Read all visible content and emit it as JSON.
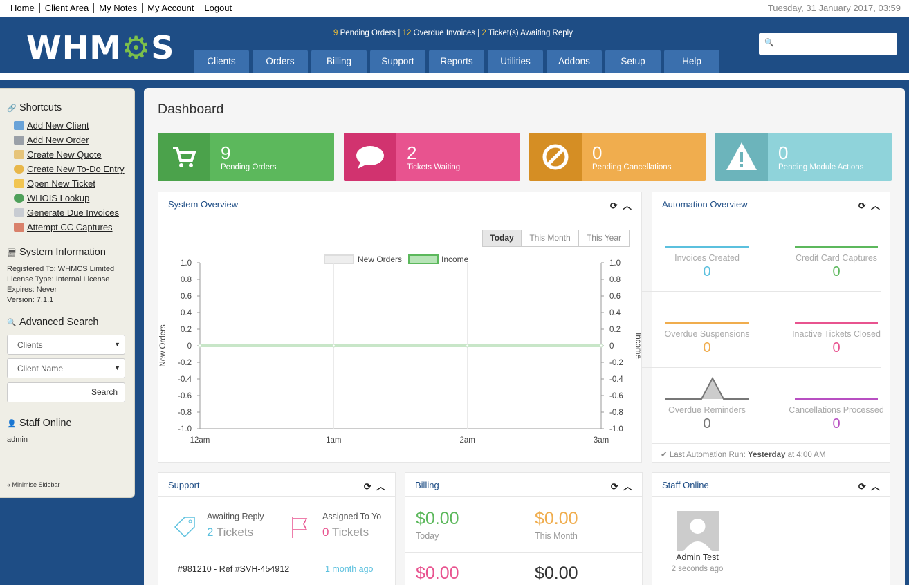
{
  "topbar": {
    "links": [
      "Home",
      "Client Area",
      "My Notes",
      "My Account",
      "Logout"
    ],
    "datetime": "Tuesday, 31 January 2017, 03:59"
  },
  "header": {
    "logo": "WHMCS",
    "alerts": {
      "pending_orders": "9",
      "pending_orders_label": "Pending Orders",
      "overdue": "12",
      "overdue_label": "Overdue Invoices",
      "tickets": "2",
      "tickets_label": "Ticket(s) Awaiting Reply",
      "separator": "|"
    },
    "search_icon": "search-icon"
  },
  "nav": [
    "Clients",
    "Orders",
    "Billing",
    "Support",
    "Reports",
    "Utilities",
    "Addons",
    "Setup",
    "Help"
  ],
  "sidebar": {
    "shortcuts_title": "Shortcuts",
    "shortcuts": [
      "Add New Client",
      "Add New Order",
      "Create New Quote",
      "Create New To-Do Entry",
      "Open New Ticket",
      "WHOIS Lookup",
      "Generate Due Invoices",
      "Attempt CC Captures"
    ],
    "sysinfo_title": "System Information",
    "sysinfo": [
      "Registered To: WHMCS Limited",
      "License Type: Internal License",
      "Expires: Never",
      "Version: 7.1.1"
    ],
    "adv_title": "Advanced Search",
    "adv_select1": "Clients",
    "adv_select2": "Client Name",
    "search_button": "Search",
    "staff_title": "Staff Online",
    "staff_name": "admin",
    "minimise": "« Minimise Sidebar"
  },
  "main": {
    "title": "Dashboard",
    "stats": [
      {
        "num": "9",
        "label": "Pending Orders",
        "color": "#5cb85c",
        "dark": "#4ba24b"
      },
      {
        "num": "2",
        "label": "Tickets Waiting",
        "color": "#e8538f",
        "dark": "#d1336f"
      },
      {
        "num": "0",
        "label": "Pending Cancellations",
        "color": "#f0ad4e",
        "dark": "#d58e24"
      },
      {
        "num": "0",
        "label": "Pending Module Actions",
        "color": "#8fd3da",
        "dark": "#6cb4bb"
      }
    ],
    "system_overview": {
      "title": "System Overview",
      "ranges": [
        "Today",
        "This Month",
        "This Year"
      ],
      "legend": [
        "New Orders",
        "Income"
      ]
    },
    "automation": {
      "title": "Automation Overview",
      "items": [
        {
          "label": "Invoices Created",
          "value": "0",
          "color": "#5bc0de"
        },
        {
          "label": "Credit Card Captures",
          "value": "0",
          "color": "#5cb85c"
        },
        {
          "label": "Overdue Suspensions",
          "value": "0",
          "color": "#f0ad4e"
        },
        {
          "label": "Inactive Tickets Closed",
          "value": "0",
          "color": "#e8538f"
        },
        {
          "label": "Overdue Reminders",
          "value": "0",
          "color": "#777777"
        },
        {
          "label": "Cancellations Processed",
          "value": "0",
          "color": "#b84fc2"
        }
      ],
      "last_run_prefix": "Last Automation Run:",
      "last_run_day": "Yesterday",
      "last_run_time": "at 4:00 AM"
    },
    "support": {
      "title": "Support",
      "awaiting_label": "Awaiting Reply",
      "awaiting_value": "2",
      "tickets_word": "Tickets",
      "assigned_label": "Assigned To Yo",
      "assigned_value": "0",
      "ticket_ref": "#981210 - Ref #SVH-454912",
      "ticket_time": "1 month ago"
    },
    "billing": {
      "title": "Billing",
      "today": "$0.00",
      "today_label": "Today",
      "month": "$0.00",
      "month_label": "This Month",
      "bl": "$0.00",
      "br": "$0.00"
    },
    "staff": {
      "title": "Staff Online",
      "name": "Admin Test",
      "time": "2 seconds ago"
    }
  },
  "chart_data": {
    "type": "line",
    "x": [
      "12am",
      "1am",
      "2am",
      "3am"
    ],
    "series": [
      {
        "name": "New Orders",
        "values": [
          0,
          0,
          0,
          0
        ]
      },
      {
        "name": "Income",
        "values": [
          0,
          0,
          0,
          0
        ]
      }
    ],
    "ylabel": "New Orders",
    "y2label": "Income",
    "ylim": [
      -1,
      1
    ],
    "y2lim": [
      -1,
      1
    ],
    "yticks": [
      "1.0",
      "0.8",
      "0.6",
      "0.4",
      "0.2",
      "0",
      "-0.2",
      "-0.4",
      "-0.6",
      "-0.8",
      "-1.0"
    ],
    "y2ticks": [
      "1.0",
      "0.8",
      "0.6",
      "0.4",
      "0.2",
      "0",
      "-0.2",
      "-0.4",
      "-0.6",
      "-0.8",
      "-1.0"
    ],
    "legend": "top-center",
    "grid": true
  }
}
